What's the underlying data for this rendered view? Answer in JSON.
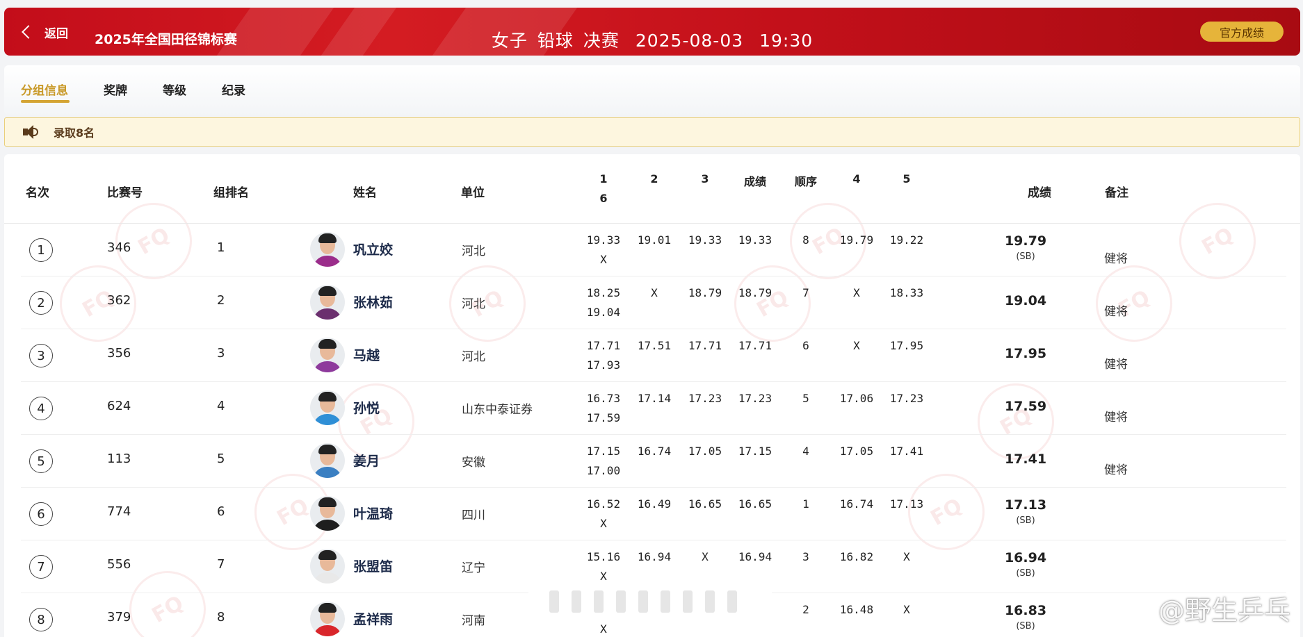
{
  "header": {
    "back_label": "返回",
    "event_name": "2025年全国田径锦标赛",
    "event_group": "女子",
    "event_discipline": "铅球",
    "event_round": "决赛",
    "date": "2025-08-03",
    "time": "19:30",
    "official_button": "官方成绩"
  },
  "tabs": [
    {
      "label": "分组信息",
      "active": true
    },
    {
      "label": "奖牌",
      "active": false
    },
    {
      "label": "等级",
      "active": false
    },
    {
      "label": "纪录",
      "active": false
    }
  ],
  "notice": {
    "text": "录取8名"
  },
  "columns": {
    "rank": "名次",
    "bib": "比赛号",
    "group_rank": "组排名",
    "name": "姓名",
    "unit": "单位",
    "a1": "1",
    "a2": "2",
    "a3": "3",
    "mid": "成绩",
    "order": "顺序",
    "a4": "4",
    "a5": "5",
    "a6": "6",
    "result": "成绩",
    "remark": "备注"
  },
  "rows": [
    {
      "rank": "1",
      "bib": "346",
      "group_rank": "1",
      "name": "巩立姣",
      "unit": "河北",
      "a1": "19.33",
      "a2": "19.01",
      "a3": "19.33",
      "mid": "19.33",
      "order": "8",
      "a4": "19.79",
      "a5": "19.22",
      "a6": "X",
      "result": "19.79",
      "sb": "(SB)",
      "remark": "健将",
      "shirt": "#9b2d8b"
    },
    {
      "rank": "2",
      "bib": "362",
      "group_rank": "2",
      "name": "张林茹",
      "unit": "河北",
      "a1": "18.25",
      "a2": "X",
      "a3": "18.79",
      "mid": "18.79",
      "order": "7",
      "a4": "X",
      "a5": "18.33",
      "a6": "19.04",
      "result": "19.04",
      "sb": "",
      "remark": "健将",
      "shirt": "#6b2f6e"
    },
    {
      "rank": "3",
      "bib": "356",
      "group_rank": "3",
      "name": "马越",
      "unit": "河北",
      "a1": "17.71",
      "a2": "17.51",
      "a3": "17.71",
      "mid": "17.71",
      "order": "6",
      "a4": "X",
      "a5": "17.95",
      "a6": "17.93",
      "result": "17.95",
      "sb": "",
      "remark": "健将",
      "shirt": "#8e3a9c"
    },
    {
      "rank": "4",
      "bib": "624",
      "group_rank": "4",
      "name": "孙悦",
      "unit": "山东中泰证券",
      "a1": "16.73",
      "a2": "17.14",
      "a3": "17.23",
      "mid": "17.23",
      "order": "5",
      "a4": "17.06",
      "a5": "17.23",
      "a6": "17.59",
      "result": "17.59",
      "sb": "",
      "remark": "健将",
      "shirt": "#2f8fd6"
    },
    {
      "rank": "5",
      "bib": "113",
      "group_rank": "5",
      "name": "姜月",
      "unit": "安徽",
      "a1": "17.15",
      "a2": "16.74",
      "a3": "17.05",
      "mid": "17.15",
      "order": "4",
      "a4": "17.05",
      "a5": "17.41",
      "a6": "17.00",
      "result": "17.41",
      "sb": "",
      "remark": "健将",
      "shirt": "#3a7fc2"
    },
    {
      "rank": "6",
      "bib": "774",
      "group_rank": "6",
      "name": "叶温琦",
      "unit": "四川",
      "a1": "16.52",
      "a2": "16.49",
      "a3": "16.65",
      "mid": "16.65",
      "order": "1",
      "a4": "16.74",
      "a5": "17.13",
      "a6": "X",
      "result": "17.13",
      "sb": "(SB)",
      "remark": "",
      "shirt": "#1e1e1e"
    },
    {
      "rank": "7",
      "bib": "556",
      "group_rank": "7",
      "name": "张盟笛",
      "unit": "辽宁",
      "a1": "15.16",
      "a2": "16.94",
      "a3": "X",
      "mid": "16.94",
      "order": "3",
      "a4": "16.82",
      "a5": "X",
      "a6": "X",
      "result": "16.94",
      "sb": "(SB)",
      "remark": "",
      "shirt": "#e9e9e9"
    },
    {
      "rank": "8",
      "bib": "379",
      "group_rank": "8",
      "name": "孟祥雨",
      "unit": "河南",
      "a1": "",
      "a2": "",
      "a3": "",
      "mid": "",
      "order": "2",
      "a4": "16.48",
      "a5": "X",
      "a6": "X",
      "result": "16.83",
      "sb": "(SB)",
      "remark": "",
      "shirt": "#d9262b"
    }
  ],
  "watermark": {
    "text": "@野生乒乓"
  },
  "colors": {
    "header_red": "#c30d1a",
    "gold": "#e6b43a",
    "tab_active": "#c99a29",
    "notice_bg": "#fdf6df"
  }
}
